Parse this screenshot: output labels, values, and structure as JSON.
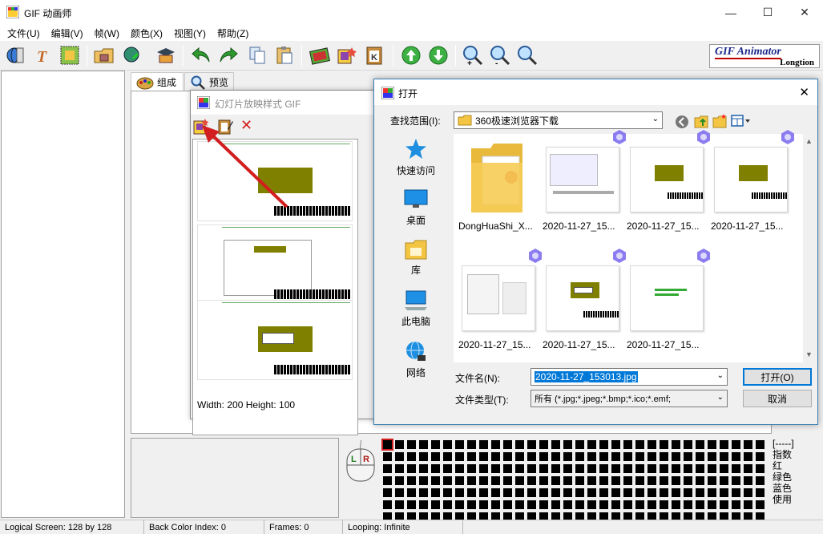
{
  "window": {
    "title": "GIF 动画师",
    "minimize": "—",
    "maximize": "☐",
    "close": "✕"
  },
  "menu": [
    "文件(U)",
    "编辑(V)",
    "帧(W)",
    "颜色(X)",
    "视图(Y)",
    "帮助(Z)"
  ],
  "logo": {
    "line1": "GIF Animator",
    "line2": "Longtion"
  },
  "tabs": [
    {
      "label": "组成",
      "icon": "palette-icon"
    },
    {
      "label": "预览",
      "icon": "magnifier-icon"
    }
  ],
  "slideshow": {
    "title": "幻灯片放映样式 GIF",
    "size_text": "Width: 200  Height: 100",
    "close_glyph": "✕"
  },
  "open_dialog": {
    "title": "打开",
    "close_glyph": "✕",
    "lookin_label": "查找范围(I):",
    "lookin_value": "360极速浏览器下载",
    "places": [
      "快速访问",
      "桌面",
      "库",
      "此电脑",
      "网络"
    ],
    "files": [
      "DongHuaShi_X...",
      "2020-11-27_15...",
      "2020-11-27_15...",
      "2020-11-27_15...",
      "2020-11-27_15...",
      "2020-11-27_15...",
      "2020-11-27_15..."
    ],
    "filename_label": "文件名(N):",
    "filename_value": "2020-11-27_153013.jpg",
    "filetype_label": "文件类型(T):",
    "filetype_value": "所有 (*.jpg;*.jpeg;*.bmp;*.ico;*.emf;",
    "open_button": "打开(O)",
    "cancel_button": "取消"
  },
  "mouse": {
    "left": "L",
    "right": "R"
  },
  "legend": [
    "[-----]",
    "指数",
    "红",
    "绿色",
    "蓝色",
    "使用"
  ],
  "status": {
    "logical": "Logical Screen: 128 by 128",
    "backcolor": "Back Color Index: 0",
    "frames": "Frames: 0",
    "looping": "Looping: Infinite"
  },
  "colors": {
    "accent": "#0078d7",
    "olive": "#808000",
    "arrow": "#d21e1e",
    "selection": "#0078d7"
  }
}
